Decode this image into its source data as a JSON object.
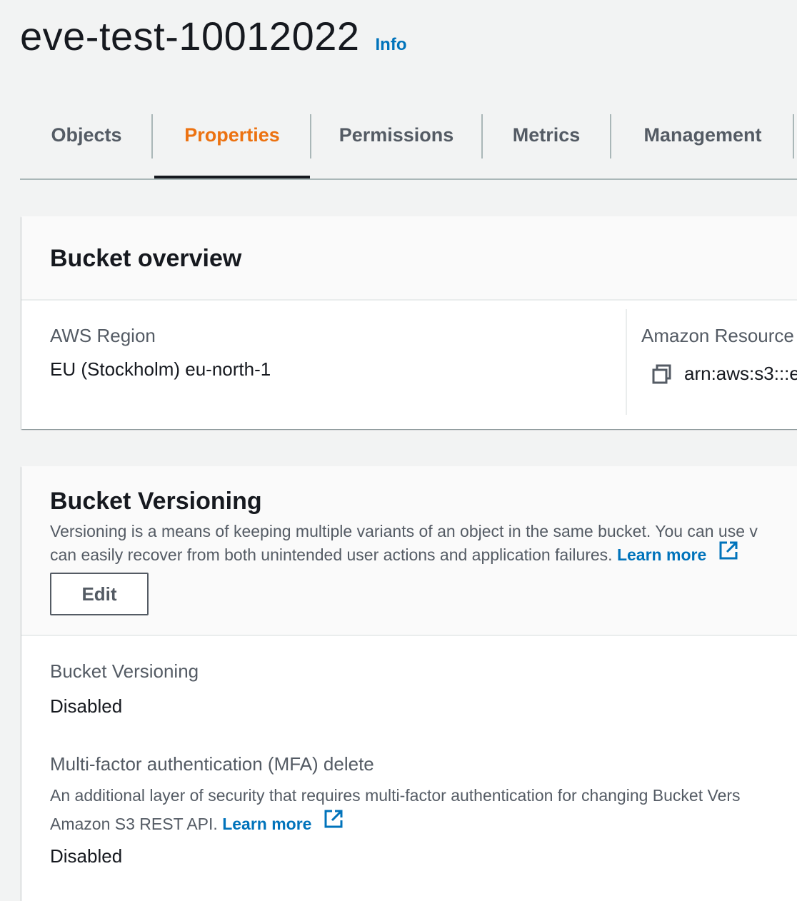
{
  "header": {
    "title": "eve-test-10012022",
    "info_label": "Info"
  },
  "tabs": [
    {
      "label": "Objects",
      "active": false
    },
    {
      "label": "Properties",
      "active": true
    },
    {
      "label": "Permissions",
      "active": false
    },
    {
      "label": "Metrics",
      "active": false
    },
    {
      "label": "Management",
      "active": false
    }
  ],
  "overview": {
    "title": "Bucket overview",
    "region_label": "AWS Region",
    "region_value": "EU (Stockholm) eu-north-1",
    "arn_label": "Amazon Resource",
    "arn_value": "arn:aws:s3:::e"
  },
  "versioning": {
    "title": "Bucket Versioning",
    "desc_line1": "Versioning is a means of keeping multiple variants of an object in the same bucket. You can use v",
    "desc_line2": "can easily recover from both unintended user actions and application failures.",
    "learn_more": "Learn more",
    "edit_label": "Edit",
    "status_label": "Bucket Versioning",
    "status_value": "Disabled",
    "mfa_label": "Multi-factor authentication (MFA) delete",
    "mfa_desc_line1": "An additional layer of security that requires multi-factor authentication for changing Bucket Vers",
    "mfa_desc_line2": "Amazon S3 REST API.",
    "mfa_learn_more": "Learn more",
    "mfa_value": "Disabled"
  },
  "colors": {
    "accent": "#ec7211",
    "link": "#0073bb",
    "text": "#16191f",
    "muted": "#545b64",
    "background": "#f2f3f3"
  },
  "icons": [
    "copy-icon",
    "external-link-icon"
  ]
}
